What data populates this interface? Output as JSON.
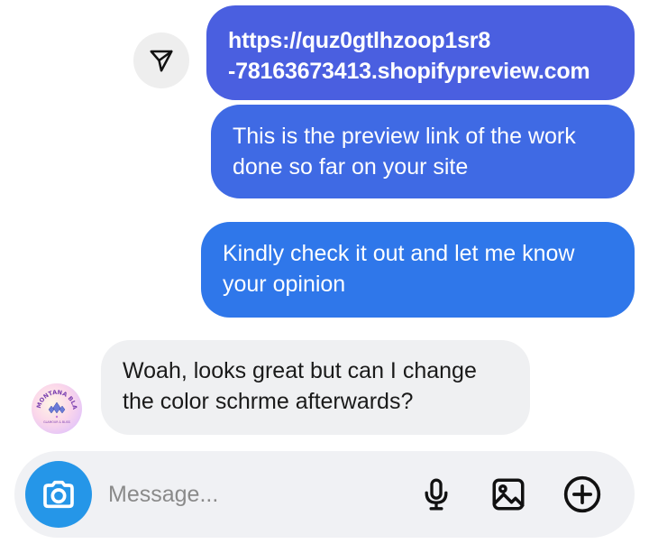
{
  "messages": [
    {
      "direction": "outgoing",
      "text": "https://quz0gtlhzoop1sr8\n-78163673413.shopifypreview.com"
    },
    {
      "direction": "outgoing",
      "text": "This is the preview link of the work\ndone so far on your site"
    },
    {
      "direction": "outgoing",
      "text": "Kindly check it out and let me know\nyour opinion"
    },
    {
      "direction": "incoming",
      "text": "Woah, looks great but can I change\nthe color schrme afterwards?"
    }
  ],
  "avatar": {
    "ring_text": "MONTANA BLAZE",
    "sub_text": "GLAMOUR & BLISS"
  },
  "composer": {
    "placeholder": "Message..."
  },
  "icons": {
    "share": "paper-plane-icon",
    "camera": "camera-icon",
    "mic": "microphone-icon",
    "gallery": "image-icon",
    "add": "plus-circle-icon"
  },
  "colors": {
    "outgoing_1": "#4a5fe0",
    "outgoing_2": "#3f6ae4",
    "outgoing_3": "#2f77ea",
    "incoming": "#eff0f2",
    "camera_button": "#2596e8"
  }
}
